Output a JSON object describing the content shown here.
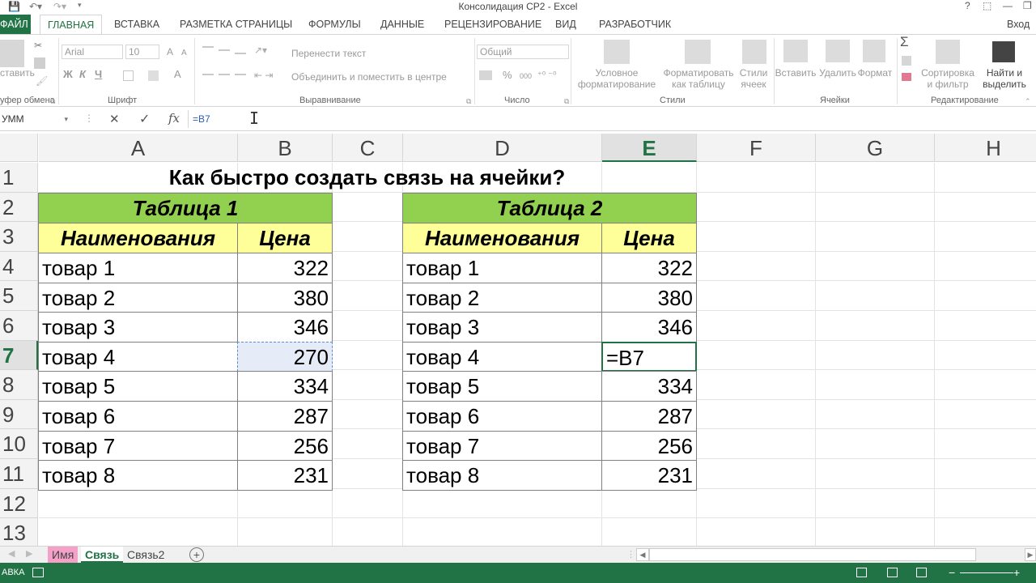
{
  "window": {
    "title": "Консолидация СР2 - Excel",
    "help_icon": "?",
    "signin": "Вход"
  },
  "tabs": [
    {
      "label": "ФАЙЛ"
    },
    {
      "label": "ГЛАВНАЯ"
    },
    {
      "label": "ВСТАВКА"
    },
    {
      "label": "РАЗМЕТКА СТРАНИЦЫ"
    },
    {
      "label": "ФОРМУЛЫ"
    },
    {
      "label": "ДАННЫЕ"
    },
    {
      "label": "РЕЦЕНЗИРОВАНИЕ"
    },
    {
      "label": "ВИД"
    },
    {
      "label": "РАЗРАБОТЧИК"
    }
  ],
  "ribbon": {
    "paste": "ставить",
    "font_name": "Arial",
    "font_size": "10",
    "bold": "Ж",
    "italic": "К",
    "underline": "Ч",
    "grow_font": "A",
    "shrink_font": "A",
    "font_color": "A",
    "wrap_text": "Перенести текст",
    "merge_center": "Объединить и поместить в центре",
    "number_format": "Общий",
    "percent": "%",
    "comma": "000",
    "cond_format_1": "Условное",
    "cond_format_2": "форматирование",
    "format_table_1": "Форматировать",
    "format_table_2": "как таблицу",
    "cell_styles_1": "Стили",
    "cell_styles_2": "ячеек",
    "insert": "Вставить",
    "delete": "Удалить",
    "format": "Формат",
    "sigma": "Σ",
    "sort_1": "Сортировка",
    "sort_2": "и фильтр",
    "find_1": "Найти и",
    "find_2": "выделить",
    "groups": {
      "clipboard": "уфер обмена",
      "font": "Шрифт",
      "alignment": "Выравнивание",
      "number": "Число",
      "styles": "Стили",
      "cells": "Ячейки",
      "editing": "Редактирование"
    }
  },
  "formula_bar": {
    "name_box": "УММ",
    "cancel": "✕",
    "enter": "✓",
    "fx": "fx",
    "content": "=B7"
  },
  "columns": [
    "A",
    "B",
    "C",
    "D",
    "E",
    "F",
    "G",
    "H"
  ],
  "rows": [
    "1",
    "2",
    "3",
    "4",
    "5",
    "6",
    "7",
    "8",
    "9",
    "10",
    "11",
    "12",
    "13"
  ],
  "sheet": {
    "title": "Как быстро создать связь на ячейки?",
    "table1": {
      "caption": "Таблица 1",
      "header_name": "Наименования",
      "header_price": "Цена",
      "rows": [
        {
          "name": "товар 1",
          "price": "322"
        },
        {
          "name": "товар 2",
          "price": "380"
        },
        {
          "name": "товар 3",
          "price": "346"
        },
        {
          "name": "товар 4",
          "price": "270"
        },
        {
          "name": "товар 5",
          "price": "334"
        },
        {
          "name": "товар 6",
          "price": "287"
        },
        {
          "name": "товар 7",
          "price": "256"
        },
        {
          "name": "товар 8",
          "price": "231"
        }
      ]
    },
    "table2": {
      "caption": "Таблица 2",
      "header_name": "Наименования",
      "header_price": "Цена",
      "rows": [
        {
          "name": "товар 1",
          "price": "322"
        },
        {
          "name": "товар 2",
          "price": "380"
        },
        {
          "name": "товар 3",
          "price": "346"
        },
        {
          "name": "товар 4",
          "price": "=B7"
        },
        {
          "name": "товар 5",
          "price": "334"
        },
        {
          "name": "товар 6",
          "price": "287"
        },
        {
          "name": "товар 7",
          "price": "256"
        },
        {
          "name": "товар 8",
          "price": "231"
        }
      ]
    }
  },
  "sheet_tabs": [
    {
      "label": "Имя"
    },
    {
      "label": "Связь"
    },
    {
      "label": "Связь2"
    }
  ],
  "add_sheet": "+",
  "status": {
    "mode": "АВКА"
  },
  "colors": {
    "excel_green": "#217346",
    "table_caption": "#92d050",
    "table_header": "#ffff99"
  }
}
